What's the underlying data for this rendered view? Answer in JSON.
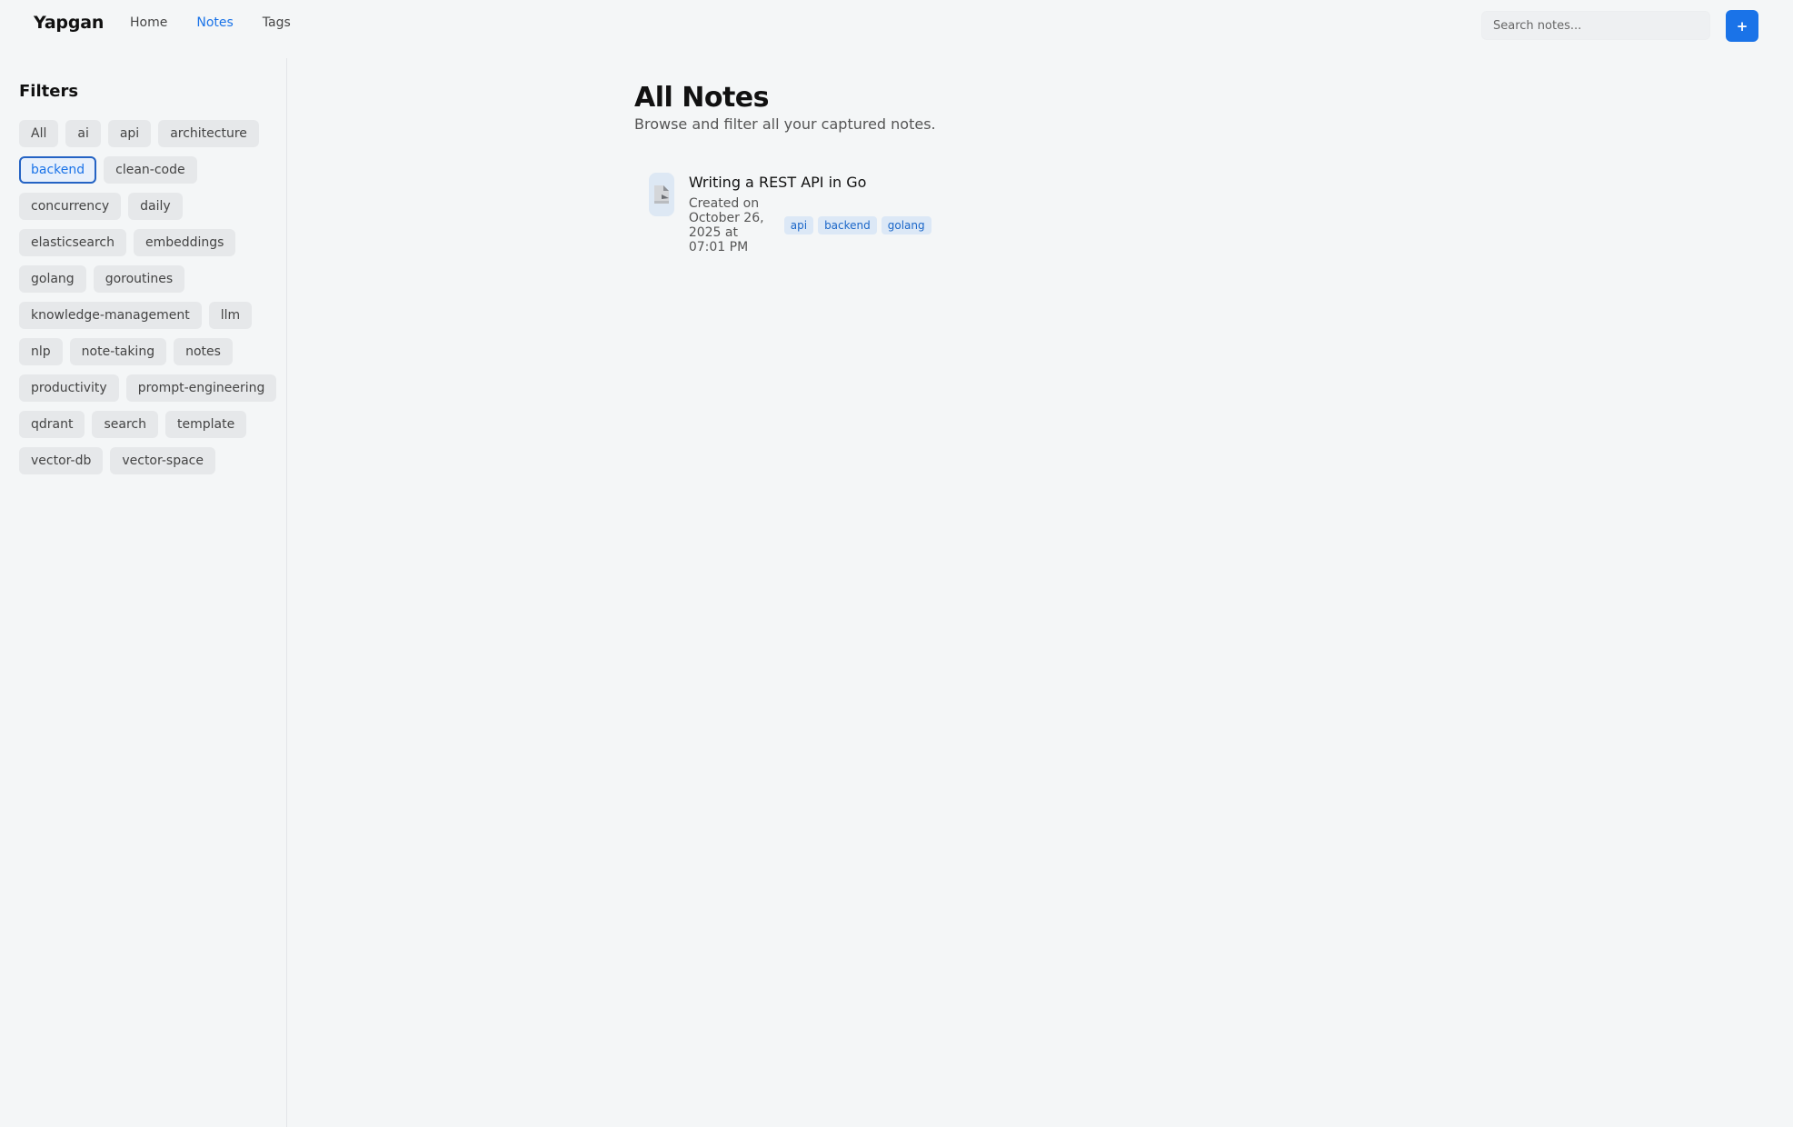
{
  "app": {
    "brand": "Yapgan"
  },
  "nav": {
    "items": [
      {
        "label": "Home",
        "active": false
      },
      {
        "label": "Notes",
        "active": true
      },
      {
        "label": "Tags",
        "active": false
      }
    ]
  },
  "search": {
    "placeholder": "Search notes...",
    "value": ""
  },
  "header": {
    "add_label": "+",
    "accent_color": "#1a73e8"
  },
  "sidebar": {
    "title": "Filters",
    "filters": [
      {
        "label": "All",
        "active": false
      },
      {
        "label": "ai",
        "active": false
      },
      {
        "label": "api",
        "active": false
      },
      {
        "label": "architecture",
        "active": false
      },
      {
        "label": "backend",
        "active": true
      },
      {
        "label": "clean-code",
        "active": false
      },
      {
        "label": "concurrency",
        "active": false
      },
      {
        "label": "daily",
        "active": false
      },
      {
        "label": "elasticsearch",
        "active": false
      },
      {
        "label": "embeddings",
        "active": false
      },
      {
        "label": "golang",
        "active": false
      },
      {
        "label": "goroutines",
        "active": false
      },
      {
        "label": "knowledge-management",
        "active": false
      },
      {
        "label": "llm",
        "active": false
      },
      {
        "label": "nlp",
        "active": false
      },
      {
        "label": "note-taking",
        "active": false
      },
      {
        "label": "notes",
        "active": false
      },
      {
        "label": "productivity",
        "active": false
      },
      {
        "label": "prompt-engineering",
        "active": false
      },
      {
        "label": "qdrant",
        "active": false
      },
      {
        "label": "search",
        "active": false
      },
      {
        "label": "template",
        "active": false
      },
      {
        "label": "vector-db",
        "active": false
      },
      {
        "label": "vector-space",
        "active": false
      }
    ]
  },
  "main": {
    "title": "All Notes",
    "subtitle": "Browse and filter all your captured notes.",
    "notes": [
      {
        "title": "Writing a REST API in Go",
        "created": "Created on October 26, 2025 at 07:01 PM",
        "icon": "document-icon",
        "tags": [
          "api",
          "backend",
          "golang"
        ]
      }
    ]
  }
}
